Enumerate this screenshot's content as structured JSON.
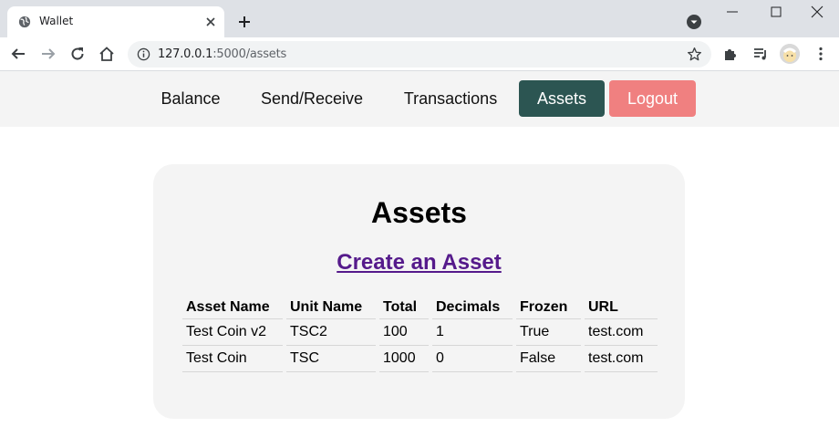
{
  "browser": {
    "tab_title": "Wallet",
    "url_host": "127.0.0.1",
    "url_path": ":5000/assets"
  },
  "icons": {
    "favicon": "globe-icon",
    "new_tab": "plus-icon",
    "back": "arrow-left-icon",
    "forward": "arrow-right-icon",
    "reload": "reload-icon",
    "home": "home-icon",
    "bookmark": "star-icon",
    "extensions": "puzzle-icon",
    "media": "media-queue-icon",
    "menu": "kebab-menu-icon"
  },
  "nav": {
    "balance": "Balance",
    "send_receive": "Send/Receive",
    "transactions": "Transactions",
    "assets": "Assets",
    "logout": "Logout"
  },
  "colors": {
    "active_nav": "#2c5552",
    "logout": "#f08080",
    "link": "#551a8b",
    "panel": "#f4f4f4"
  },
  "main": {
    "title": "Assets",
    "create_link": "Create an Asset",
    "table": {
      "headers": [
        "Asset Name",
        "Unit Name",
        "Total",
        "Decimals",
        "Frozen",
        "URL"
      ],
      "rows": [
        [
          "Test Coin v2",
          "TSC2",
          "100",
          "1",
          "True",
          "test.com"
        ],
        [
          "Test Coin",
          "TSC",
          "1000",
          "0",
          "False",
          "test.com"
        ]
      ]
    }
  }
}
